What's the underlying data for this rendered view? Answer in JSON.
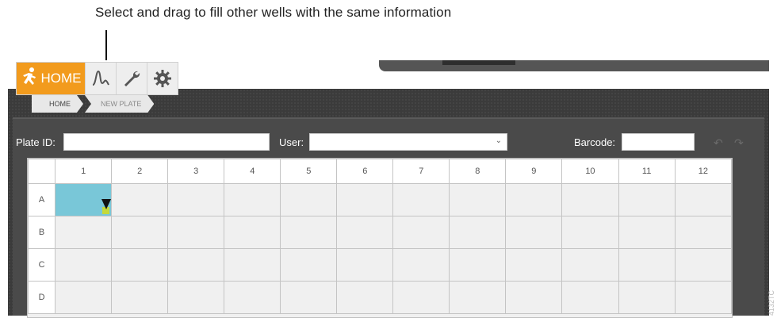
{
  "annotation": {
    "callout_text": "Select and drag to fill other wells with the same information"
  },
  "toolbar": {
    "home_label": "HOME",
    "icons": [
      "runner-icon",
      "chart-curve-icon",
      "wrench-icon",
      "gear-icon"
    ],
    "accent_color": "#f29b1d"
  },
  "breadcrumb": [
    "HOME",
    "NEW PLATE"
  ],
  "form": {
    "plate_id_label": "Plate ID:",
    "plate_id_value": "",
    "user_label": "User:",
    "user_value": "",
    "barcode_label": "Barcode:",
    "barcode_value": ""
  },
  "plate": {
    "columns": [
      "1",
      "2",
      "3",
      "4",
      "5",
      "6",
      "7",
      "8",
      "9",
      "10",
      "11",
      "12"
    ],
    "rows": [
      "A",
      "B",
      "C",
      "D"
    ],
    "selected_well": "A1",
    "selected_color": "#79c7d8",
    "handle_color": "#c5d93a"
  },
  "figure_id": "4132TC"
}
